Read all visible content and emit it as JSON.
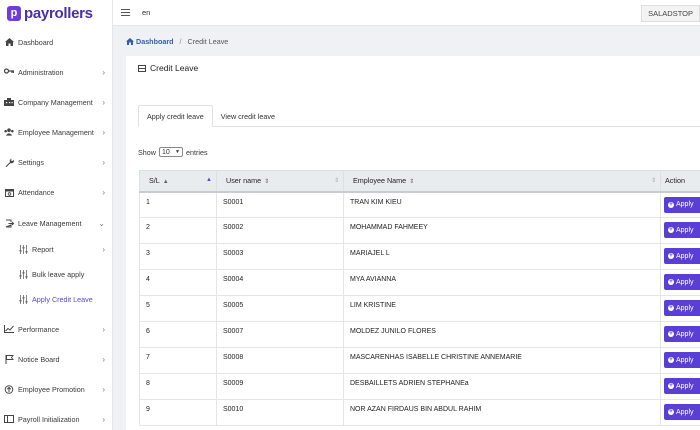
{
  "brand": {
    "name": "payrollers",
    "mark": "p"
  },
  "topbar": {
    "lang": "en",
    "company": "SALADSTOP"
  },
  "sidebar": {
    "items": [
      {
        "label": "Dashboard",
        "icon": "home-icon",
        "chevron": false
      },
      {
        "label": "Administration",
        "icon": "key-icon",
        "chevron": true
      },
      {
        "label": "Company Management",
        "icon": "building-icon",
        "chevron": true
      },
      {
        "label": "Employee Management",
        "icon": "users-icon",
        "chevron": true
      },
      {
        "label": "Settings",
        "icon": "wrench-icon",
        "chevron": true
      },
      {
        "label": "Attendance",
        "icon": "calendar-icon",
        "chevron": true
      },
      {
        "label": "Leave Management",
        "icon": "exit-icon",
        "chevron": true,
        "expanded": true
      },
      {
        "label": "Report",
        "icon": "sliders-icon",
        "chevron": true,
        "sub": true
      },
      {
        "label": "Bulk leave apply",
        "icon": "sliders-icon",
        "chevron": false,
        "sub": true
      },
      {
        "label": "Apply Credit Leave",
        "icon": "sliders-icon",
        "chevron": false,
        "sub": true,
        "active": true
      },
      {
        "label": "Performance",
        "icon": "chart-icon",
        "chevron": true
      },
      {
        "label": "Notice Board",
        "icon": "flag-icon",
        "chevron": true
      },
      {
        "label": "Employee Promotion",
        "icon": "promotion-icon",
        "chevron": true
      },
      {
        "label": "Payroll Initialization",
        "icon": "window-icon",
        "chevron": true
      }
    ]
  },
  "breadcrumb": {
    "home": "Dashboard",
    "current": "Credit Leave"
  },
  "card": {
    "title": "Credit Leave"
  },
  "tabs": [
    {
      "label": "Apply credit leave",
      "active": true
    },
    {
      "label": "View credit leave",
      "active": false
    }
  ],
  "entries": {
    "show": "Show",
    "value": "10",
    "suffix": "entries"
  },
  "table": {
    "headers": {
      "sl": "S/L",
      "username": "User name",
      "name": "Employee Name",
      "action": "Action"
    },
    "apply_label": "Apply",
    "rows": [
      {
        "sl": "1",
        "username": "S0001",
        "name": "TRAN KIM KIEU"
      },
      {
        "sl": "2",
        "username": "S0002",
        "name": "MOHAMMAD FAHMEEY"
      },
      {
        "sl": "3",
        "username": "S0003",
        "name": "MARIAJEL L"
      },
      {
        "sl": "4",
        "username": "S0004",
        "name": "MYA AVIANNA"
      },
      {
        "sl": "5",
        "username": "S0005",
        "name": "LIM KRISTINE"
      },
      {
        "sl": "6",
        "username": "S0007",
        "name": "MOLDEZ JUNILO FLORES"
      },
      {
        "sl": "7",
        "username": "S0008",
        "name": "MASCARENHAS ISABELLE CHRISTINE ANNEMARIE"
      },
      {
        "sl": "8",
        "username": "S0009",
        "name": "DESBAILLETS ADRIEN STEPHANEa"
      },
      {
        "sl": "9",
        "username": "S0010",
        "name": "NOR AZAN FIRDAUS BIN ABDUL RAHIM"
      }
    ]
  }
}
